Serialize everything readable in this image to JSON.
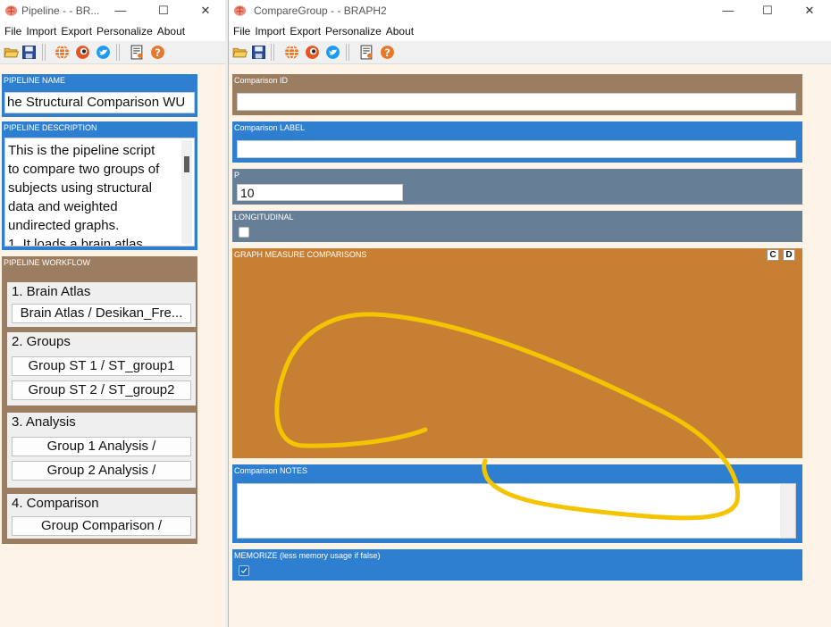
{
  "left_window": {
    "title": "Pipeline -  - BR...",
    "window_controls": {
      "minimize": "—",
      "maximize": "☐",
      "close": "✕"
    },
    "menu": [
      "File",
      "Import",
      "Export",
      "Personalize",
      "About"
    ],
    "toolbar_icons": [
      "open-folder-icon",
      "save-disk-icon",
      "globe-icon",
      "braph-logo-icon",
      "twitter-icon",
      "report-icon",
      "help-icon"
    ],
    "pipeline_name": {
      "label": "PIPELINE NAME",
      "value": "he Structural Comparison WU"
    },
    "pipeline_description": {
      "label": "PIPELINE DESCRIPTION",
      "lines": [
        "This is the pipeline script",
        "to compare two groups of",
        "subjects using structural",
        "data and weighted",
        "undirected graphs.",
        "1. It loads a brain atlas"
      ]
    },
    "pipeline_workflow": {
      "label": "PIPELINE WORKFLOW",
      "sections": [
        {
          "title": "1. Brain Atlas",
          "buttons": [
            "Brain Atlas / Desikan_Fre..."
          ]
        },
        {
          "title": "2. Groups",
          "buttons": [
            "Group ST 1 / ST_group1",
            "Group ST 2 / ST_group2"
          ]
        },
        {
          "title": "3. Analysis",
          "buttons": [
            "Group 1 Analysis /",
            "Group 2 Analysis /"
          ]
        },
        {
          "title": "4. Comparison",
          "buttons": [
            "Group Comparison /"
          ]
        }
      ]
    }
  },
  "right_window": {
    "title": "CompareGroup -  - BRAPH2",
    "window_controls": {
      "minimize": "—",
      "maximize": "☐",
      "close": "✕"
    },
    "menu": [
      "File",
      "Import",
      "Export",
      "Personalize",
      "About"
    ],
    "toolbar_icons": [
      "open-folder-icon",
      "save-disk-icon",
      "globe-icon",
      "braph-logo-icon",
      "twitter-icon",
      "report-icon",
      "help-icon"
    ],
    "comparison_id": {
      "label": "Comparison ID",
      "value": ""
    },
    "comparison_label": {
      "label": "Comparison LABEL",
      "value": ""
    },
    "p": {
      "label": "P",
      "value": "10"
    },
    "longitudinal": {
      "label": "LONGITUDINAL",
      "checked": false
    },
    "graph_measure_comparisons": {
      "label": "GRAPH MEASURE COMPARISONS",
      "buttons": [
        "C",
        "D"
      ]
    },
    "comparison_notes": {
      "label": "Comparison NOTES",
      "value": ""
    },
    "memorize": {
      "label": "MEMORIZE (less memory usage if false)",
      "checked": true
    }
  },
  "colors": {
    "blue_panel": "#2f7fd0",
    "brown_panel": "#9b7d62",
    "slate_panel": "#667f96",
    "orange_panel": "#c77f34",
    "background": "#fdf3e6",
    "annotation_stroke": "#f5c400"
  }
}
